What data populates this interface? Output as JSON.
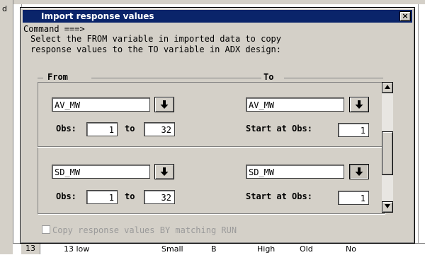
{
  "background": {
    "left_label": "d",
    "row": [
      "13",
      "13 low",
      "Small",
      "B",
      "High",
      "Old",
      "No"
    ]
  },
  "dialog": {
    "title": "Import response values",
    "close_glyph": "×",
    "command": "Command ===>",
    "instructions": [
      "Select the FROM variable in imported data to copy",
      "response values to the TO variable in ADX design:"
    ],
    "from_header": "From",
    "to_header": "To",
    "rows": [
      {
        "from_variable": "AV_MW",
        "obs_label": "Obs:",
        "obs_from": "1",
        "to_label": "to",
        "obs_to": "32",
        "to_variable": "AV_MW",
        "start_label": "Start at Obs:",
        "start_obs": "1"
      },
      {
        "from_variable": "SD_MW",
        "obs_label": "Obs:",
        "obs_from": "1",
        "to_label": "to",
        "obs_to": "32",
        "to_variable": "SD_MW",
        "start_label": "Start at Obs:",
        "start_obs": "1"
      }
    ],
    "checkbox_label": "Copy response values BY matching RUN",
    "checkbox_checked": false,
    "checkbox_enabled": false
  },
  "colors": {
    "titlebar": "#0a246a",
    "face": "#d4d0c8"
  }
}
